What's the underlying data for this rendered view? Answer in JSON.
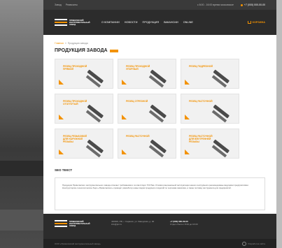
{
  "topbar": {
    "links": [
      "Завод",
      "Реквизиты"
    ],
    "hours": "с 8:00 - 16:00 время московское",
    "phone": "+7 (000) 000-00-00"
  },
  "header": {
    "logo_text": "ПРИВОЛЖСКИЙ ИНСТРУМЕНТАЛЬНЫЙ ЗАВОД",
    "nav": [
      "О КОМПАНИИ",
      "НОВОСТИ",
      "ПРОДУКЦИЯ",
      "ВАКАНСИИ",
      "ONLINE"
    ],
    "cart_label": "КОРЗИНА"
  },
  "breadcrumb": {
    "home": "Главная",
    "separator": "»",
    "current": "Продукция завода"
  },
  "page_title": "ПРОДУКЦИЯ ЗАВОДА",
  "products": [
    {
      "label": "РЕЗЕЦ ПРОХОДНОЙ ПРЯМОЙ"
    },
    {
      "label": "РЕЗЕЦ ПРОХОДНОЙ УПОРНЫЙ"
    },
    {
      "label": "РЕЗЕЦ ПОДРЕЗНОЙ"
    },
    {
      "label": "РЕЗЕЦ ПРОХОДНОЙ ОТОГНУТЫЙ"
    },
    {
      "label": "РЕЗЕЦ ОТРЕЗНОЙ"
    },
    {
      "label": "РЕЗЕЦ РАСТОЧНОЙ"
    },
    {
      "label": "РЕЗЕЦ РЕЗЬБОВОЙ ДЛЯ НАРУЖНОЙ РЕЗЬБЫ"
    },
    {
      "label": "РЕЗЕЦ РАСТОЧНОЙ"
    },
    {
      "label": "РЕЗЕЦ РАСТОЧНОЙ ДЛЯ ВНУТРЕННЕЙ РЕЗЬБЫ"
    }
  ],
  "seo": {
    "title": "SEO ТЕКСТ",
    "text": "Продукция Приволжского инструментального завода отвечает требованиям и соответствует ГОСТам. Условия рациональной эксплуатации нашего инструмента рекомендованы ведущими предприятиями. Конструкторско-технологическое бюро «Приволжского» проводит разработку новых видов продукции и изделий по чертежам заказчика, а также поставку инструмента для предприятий."
  },
  "footer": {
    "logo_text": "ПРИВОЛЖСКИЙ ИНСТРУМЕНТАЛЬНЫЙ ЗАВОД",
    "address": "430000, РФ, г. Саранск, ул. Заводская, д. 00",
    "email": "info@piz.ru",
    "phone": "+7 (000) 000-00-00",
    "hours": "Отдел сбыта с 8:00 до 16:00",
    "copyright": "ООО «Приволжский инструментальный завод»",
    "developer": "Разработка сайта"
  },
  "colors": {
    "accent": "#f39200",
    "dark": "#2c2c2c"
  }
}
